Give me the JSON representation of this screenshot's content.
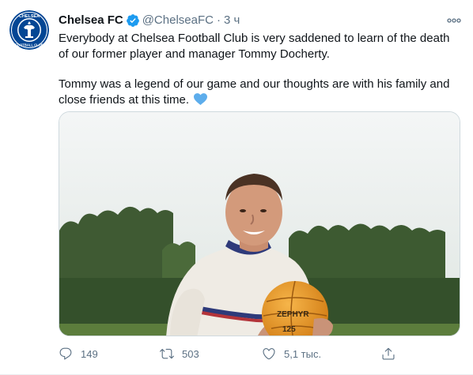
{
  "tweet": {
    "author": {
      "display_name": "Chelsea FC",
      "handle": "@ChelseaFC",
      "separator": "·",
      "time": "3 ч",
      "avatar_icon": "chelsea-crest-icon"
    },
    "text": {
      "paragraph1": "Everybody at Chelsea Football Club is very saddened to learn of the death of our former player and manager Tommy Docherty.",
      "paragraph2": "Tommy was a legend of our game and our thoughts are with his family and close friends at this time."
    },
    "emoji": "blue-heart-icon",
    "media": {
      "ball_text": "ZEPHYR",
      "ball_number": "125"
    },
    "actions": {
      "replies": "149",
      "retweets": "503",
      "likes": "5,1 тыс."
    },
    "colors": {
      "verified": "#1d9bf0",
      "heart": "#5dadec",
      "muted": "#5b7083",
      "chelsea_blue": "#034694"
    }
  }
}
